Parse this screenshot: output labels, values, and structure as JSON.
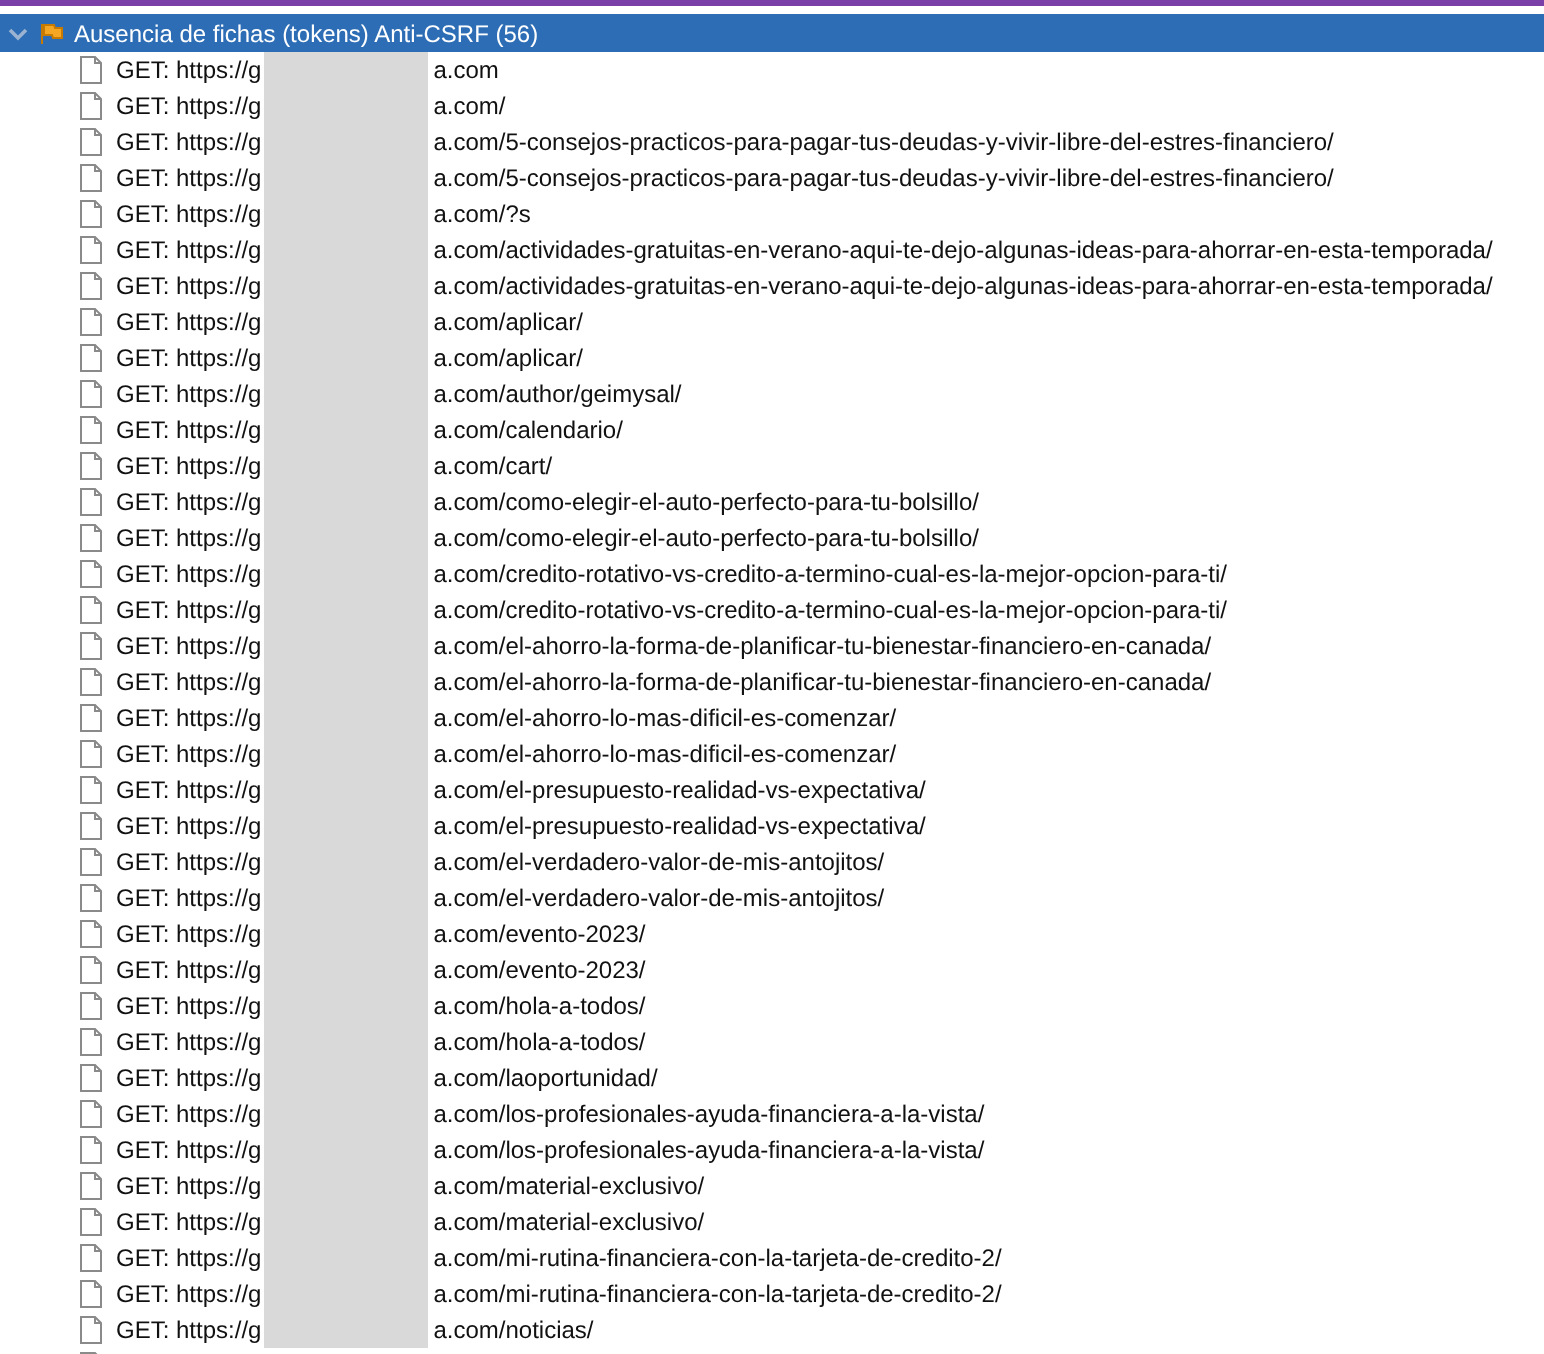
{
  "alert_node": {
    "label": "Ausencia de fichas (tokens) Anti-CSRF (56)",
    "expanded": true,
    "selected": true
  },
  "requests": [
    {
      "prefix": "GET: https://g",
      "suffix": "a.com"
    },
    {
      "prefix": "GET: https://g",
      "suffix": "a.com/"
    },
    {
      "prefix": "GET: https://g",
      "suffix": "a.com/5-consejos-practicos-para-pagar-tus-deudas-y-vivir-libre-del-estres-financiero/"
    },
    {
      "prefix": "GET: https://g",
      "suffix": "a.com/5-consejos-practicos-para-pagar-tus-deudas-y-vivir-libre-del-estres-financiero/"
    },
    {
      "prefix": "GET: https://g",
      "suffix": "a.com/?s"
    },
    {
      "prefix": "GET: https://g",
      "suffix": "a.com/actividades-gratuitas-en-verano-aqui-te-dejo-algunas-ideas-para-ahorrar-en-esta-temporada/"
    },
    {
      "prefix": "GET: https://g",
      "suffix": "a.com/actividades-gratuitas-en-verano-aqui-te-dejo-algunas-ideas-para-ahorrar-en-esta-temporada/"
    },
    {
      "prefix": "GET: https://g",
      "suffix": "a.com/aplicar/"
    },
    {
      "prefix": "GET: https://g",
      "suffix": "a.com/aplicar/"
    },
    {
      "prefix": "GET: https://g",
      "suffix": "a.com/author/geimysal/"
    },
    {
      "prefix": "GET: https://g",
      "suffix": "a.com/calendario/"
    },
    {
      "prefix": "GET: https://g",
      "suffix": "a.com/cart/"
    },
    {
      "prefix": "GET: https://g",
      "suffix": "a.com/como-elegir-el-auto-perfecto-para-tu-bolsillo/"
    },
    {
      "prefix": "GET: https://g",
      "suffix": "a.com/como-elegir-el-auto-perfecto-para-tu-bolsillo/"
    },
    {
      "prefix": "GET: https://g",
      "suffix": "a.com/credito-rotativo-vs-credito-a-termino-cual-es-la-mejor-opcion-para-ti/"
    },
    {
      "prefix": "GET: https://g",
      "suffix": "a.com/credito-rotativo-vs-credito-a-termino-cual-es-la-mejor-opcion-para-ti/"
    },
    {
      "prefix": "GET: https://g",
      "suffix": "a.com/el-ahorro-la-forma-de-planificar-tu-bienestar-financiero-en-canada/"
    },
    {
      "prefix": "GET: https://g",
      "suffix": "a.com/el-ahorro-la-forma-de-planificar-tu-bienestar-financiero-en-canada/"
    },
    {
      "prefix": "GET: https://g",
      "suffix": "a.com/el-ahorro-lo-mas-dificil-es-comenzar/"
    },
    {
      "prefix": "GET: https://g",
      "suffix": "a.com/el-ahorro-lo-mas-dificil-es-comenzar/"
    },
    {
      "prefix": "GET: https://g",
      "suffix": "a.com/el-presupuesto-realidad-vs-expectativa/"
    },
    {
      "prefix": "GET: https://g",
      "suffix": "a.com/el-presupuesto-realidad-vs-expectativa/"
    },
    {
      "prefix": "GET: https://g",
      "suffix": "a.com/el-verdadero-valor-de-mis-antojitos/"
    },
    {
      "prefix": "GET: https://g",
      "suffix": "a.com/el-verdadero-valor-de-mis-antojitos/"
    },
    {
      "prefix": "GET: https://g",
      "suffix": "a.com/evento-2023/"
    },
    {
      "prefix": "GET: https://g",
      "suffix": "a.com/evento-2023/"
    },
    {
      "prefix": "GET: https://g",
      "suffix": "a.com/hola-a-todos/"
    },
    {
      "prefix": "GET: https://g",
      "suffix": "a.com/hola-a-todos/"
    },
    {
      "prefix": "GET: https://g",
      "suffix": "a.com/laoportunidad/"
    },
    {
      "prefix": "GET: https://g",
      "suffix": "a.com/los-profesionales-ayuda-financiera-a-la-vista/"
    },
    {
      "prefix": "GET: https://g",
      "suffix": "a.com/los-profesionales-ayuda-financiera-a-la-vista/"
    },
    {
      "prefix": "GET: https://g",
      "suffix": "a.com/material-exclusivo/"
    },
    {
      "prefix": "GET: https://g",
      "suffix": "a.com/material-exclusivo/"
    },
    {
      "prefix": "GET: https://g",
      "suffix": "a.com/mi-rutina-financiera-con-la-tarjeta-de-credito-2/"
    },
    {
      "prefix": "GET: https://g",
      "suffix": "a.com/mi-rutina-financiera-con-la-tarjeta-de-credito-2/"
    },
    {
      "prefix": "GET: https://g",
      "suffix": "a.com/noticias/"
    }
  ]
}
